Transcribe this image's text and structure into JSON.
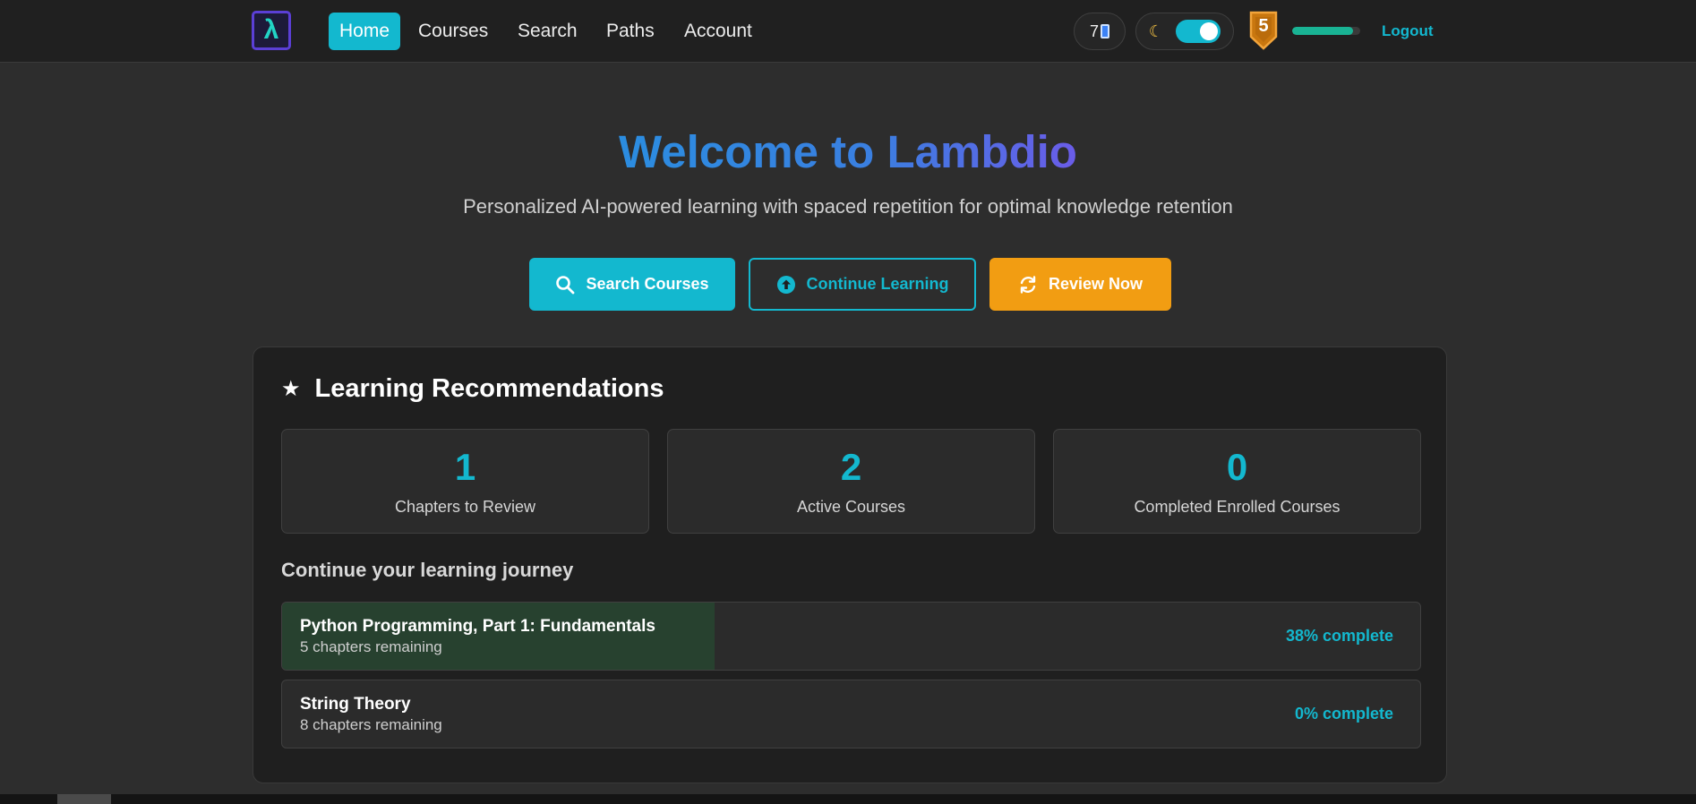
{
  "nav": {
    "logo_glyph": "λ",
    "links": [
      "Home",
      "Courses",
      "Search",
      "Paths",
      "Account"
    ],
    "streak_count": "7",
    "level": "5",
    "xp_fraction": 0.9,
    "logout_label": "Logout"
  },
  "hero": {
    "title": "Welcome to Lambdio",
    "subtitle": "Personalized AI-powered learning with spaced repetition for optimal knowledge retention",
    "buttons": {
      "search": "Search Courses",
      "continue": "Continue Learning",
      "review": "Review Now"
    }
  },
  "recommendations": {
    "title": "Learning Recommendations",
    "stats": [
      {
        "value": "1",
        "label": "Chapters to Review"
      },
      {
        "value": "2",
        "label": "Active Courses"
      },
      {
        "value": "0",
        "label": "Completed Enrolled Courses"
      }
    ],
    "journey_title": "Continue your learning journey",
    "courses": [
      {
        "name": "Python Programming, Part 1: Fundamentals",
        "remaining": "5 chapters remaining",
        "percent_label": "38% complete",
        "progress": 0.38
      },
      {
        "name": "String Theory",
        "remaining": "8 chapters remaining",
        "percent_label": "0% complete",
        "progress": 0
      }
    ]
  },
  "colors": {
    "accent": "#13b8cf",
    "review": "#f29d12",
    "progress_fill": "#27412f"
  },
  "icons": {
    "logo": "lambda-logo-icon",
    "streak": "phone-icon",
    "theme": "moon-icon",
    "level": "shield-badge-icon",
    "search": "search-icon",
    "continue": "arrow-up-circle-icon",
    "review": "refresh-icon",
    "recommendations": "star-icon"
  }
}
